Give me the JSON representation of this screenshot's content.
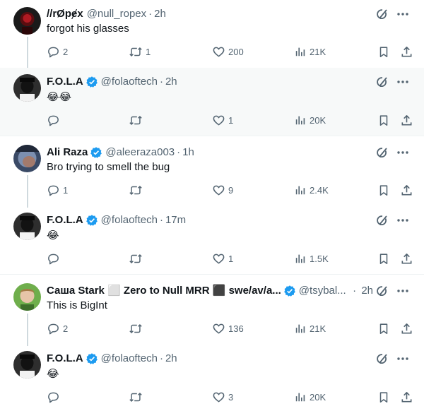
{
  "tweets": [
    {
      "name": "//rØpɇx",
      "verified": false,
      "handle": "@null_ropex",
      "time": "2h",
      "text": "forgot his glasses",
      "replies": "2",
      "retweets": "1",
      "likes": "200",
      "views": "21K"
    },
    {
      "name": "F.O.L.A",
      "verified": true,
      "handle": "@folaoftech",
      "time": "2h",
      "text": "😂😂",
      "replies": "",
      "retweets": "",
      "likes": "1",
      "views": "20K"
    },
    {
      "name": "Ali Raza",
      "verified": true,
      "handle": "@aleeraza003",
      "time": "1h",
      "text": "Bro trying to smell the bug",
      "replies": "1",
      "retweets": "",
      "likes": "9",
      "views": "2.4K"
    },
    {
      "name": "F.O.L.A",
      "verified": true,
      "handle": "@folaoftech",
      "time": "17m",
      "text": "😂",
      "replies": "",
      "retweets": "",
      "likes": "1",
      "views": "1.5K"
    },
    {
      "name": "Саша Stark ⬜ Zero to Null MRR ⬛ swe/av/a...",
      "verified": true,
      "handle": "@tsybal...",
      "time": "2h",
      "text": "This is BigInt",
      "replies": "2",
      "retweets": "",
      "likes": "136",
      "views": "21K"
    },
    {
      "name": "F.O.L.A",
      "verified": true,
      "handle": "@folaoftech",
      "time": "2h",
      "text": "😂",
      "replies": "",
      "retweets": "",
      "likes": "3",
      "views": "20K"
    }
  ],
  "separator": "·",
  "icons": {
    "grok": "grok-icon",
    "more": "more-icon",
    "reply": "reply-icon",
    "retweet": "retweet-icon",
    "like": "heart-icon",
    "views": "views-icon",
    "bookmark": "bookmark-icon",
    "share": "share-icon",
    "verified": "verified-badge-icon"
  },
  "colors": {
    "verified": "#1d9bf0",
    "text_secondary": "#536471",
    "highlight_bg": "#f7f9f9",
    "thread_line": "#cfd9de"
  }
}
